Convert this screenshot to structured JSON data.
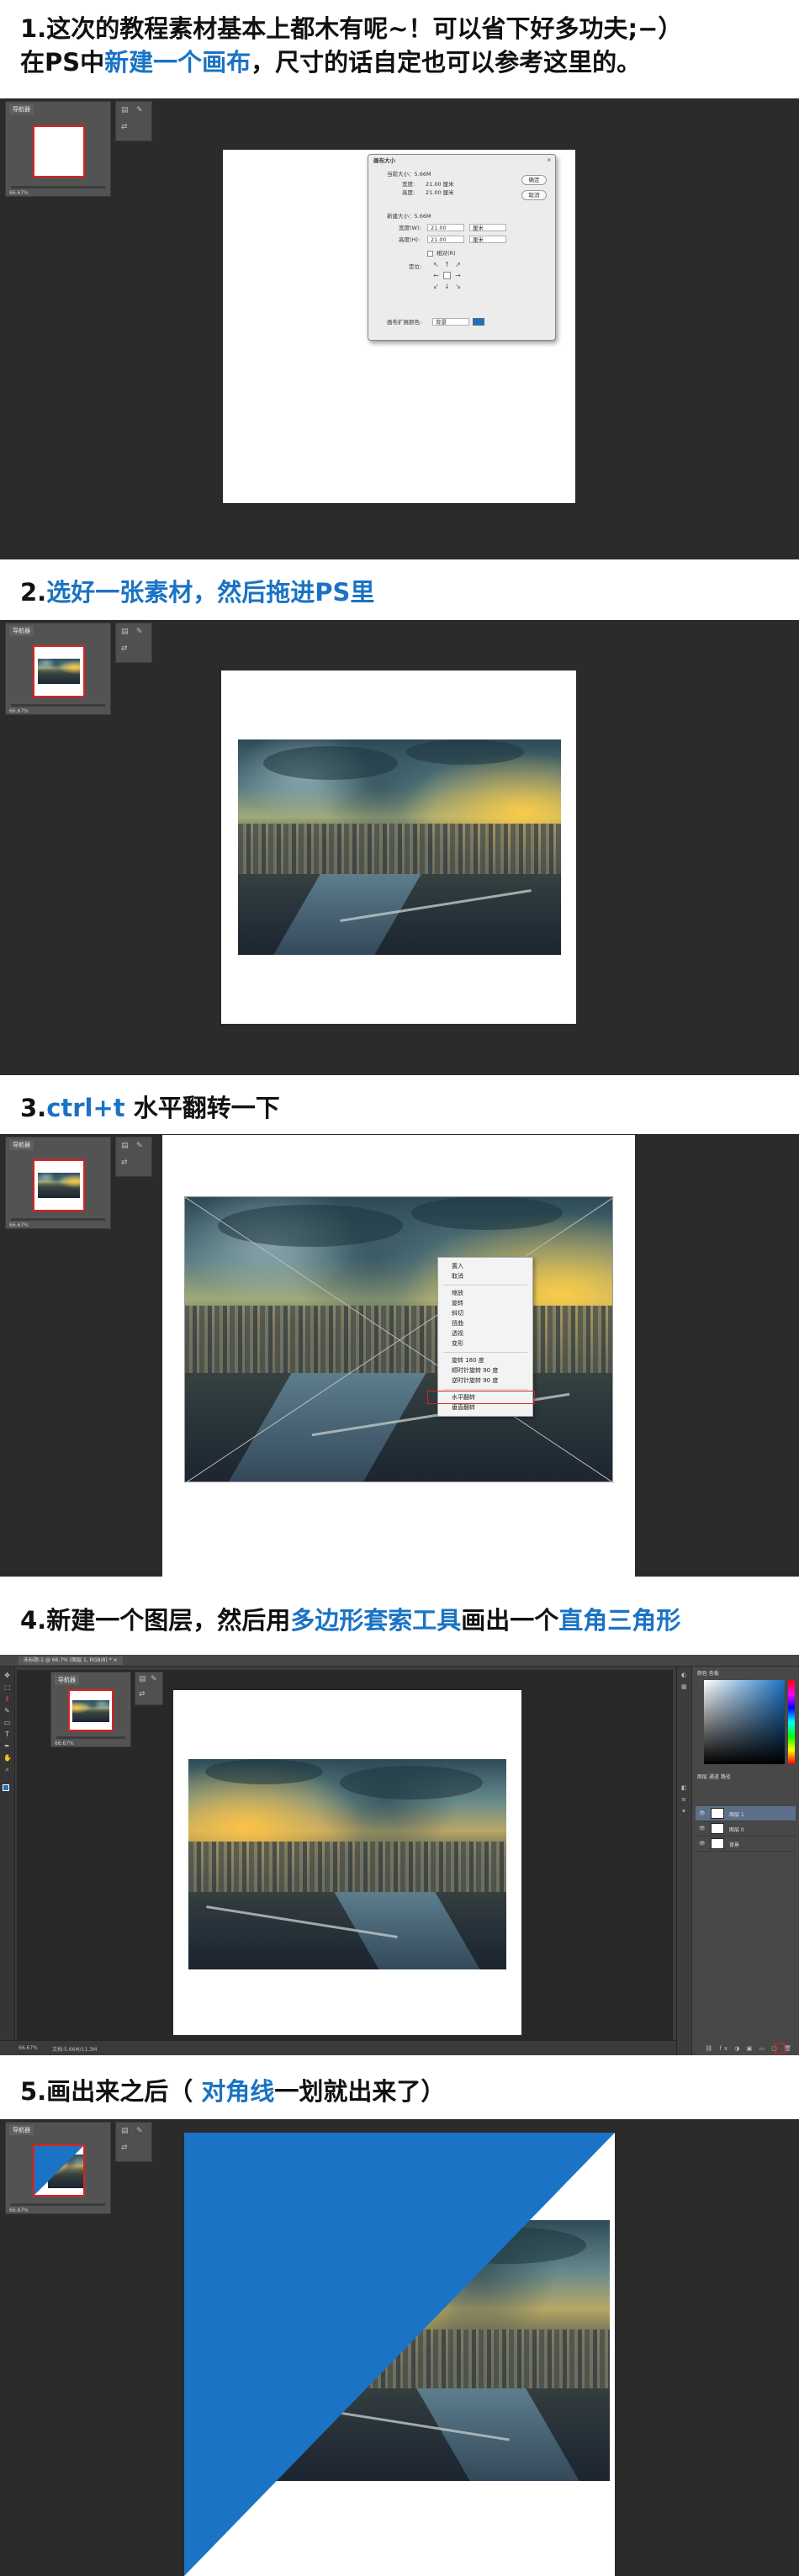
{
  "steps": [
    {
      "line1_plain": "1.这次的教程素材基本上都木有呢~！可以省下好多功夫;−）",
      "line2_prefix": "在PS中",
      "line2_blue": "新建一个画布",
      "line2_suffix": "，尺寸的话自定也可以参考这里的。"
    },
    {
      "prefix": "2.",
      "blue": "选好一张素材，然后拖进PS里"
    },
    {
      "prefix": "3.",
      "blue": "ctrl+t",
      "suffix": "  水平翻转一下"
    },
    {
      "prefix": "4.新建一个图层，然后用",
      "blue1": "多边形套索工具",
      "middle": "画出一个",
      "blue2": "直角三角形"
    },
    {
      "prefix": "5.画出来之后（ ",
      "blue": "对角线",
      "suffix": "一划就出来了）"
    }
  ],
  "navigator": {
    "tab_label": "导航器",
    "zoom_values": [
      "66.67%",
      "66.67%",
      "66.67%",
      "66.67%"
    ]
  },
  "dialog": {
    "title": "画布大小",
    "current_size_label": "当前大小：5.66M",
    "current_width_label": "宽度:",
    "current_width_value": "21.00 厘米",
    "current_height_label": "高度:",
    "current_height_value": "21.00 厘米",
    "new_size_label": "新建大小：5.66M",
    "width_label": "宽度(W):",
    "width_value": "21.00",
    "width_unit": "厘米",
    "height_label": "高度(H):",
    "height_value": "21.00",
    "height_unit": "厘米",
    "relative_label": "相对(R)",
    "anchor_label": "定位:",
    "extension_label": "画布扩展颜色:",
    "extension_value": "背景",
    "ok_label": "确定",
    "cancel_label": "取消"
  },
  "context_menu": {
    "items": [
      "置入",
      "取消",
      "缩放",
      "旋转",
      "斜切",
      "扭曲",
      "透视",
      "变形",
      "旋转 180 度",
      "顺时针旋转 90 度",
      "逆时针旋转 90 度",
      "水平翻转",
      "垂直翻转"
    ],
    "highlighted_item": "水平翻转"
  },
  "ps_ui": {
    "doc_tab": "未标题-1 @ 66.7% (图层 1, RGB/8) *  ×",
    "status_zoom": "66.67%",
    "status_doc": "文档:5.66M/11.3M",
    "panel_tabs_top": "颜色   色板",
    "panel_tabs_layers": "图层   通道   路径",
    "layers": [
      {
        "name": "图层 1"
      },
      {
        "name": "图层 0"
      },
      {
        "name": "背景"
      }
    ]
  },
  "colors": {
    "accent_blue": "#1a73c4",
    "dark_background": "#2b2b2b",
    "highlight_red": "#e02020"
  },
  "icons": {
    "tools": [
      "move-icon",
      "marquee-icon",
      "lasso-icon",
      "brush-icon",
      "eraser-icon",
      "text-icon",
      "pen-icon",
      "hand-icon",
      "zoom-icon"
    ]
  }
}
